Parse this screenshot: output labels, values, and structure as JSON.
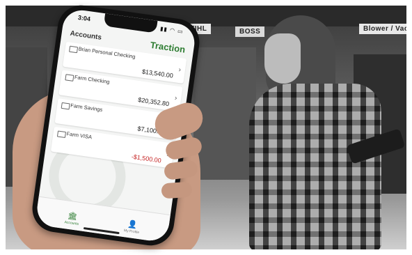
{
  "store": {
    "signs": [
      "STIHL",
      "BOSS",
      "Blower / Vacs"
    ]
  },
  "phone": {
    "status_time": "3:04",
    "status_icons": "▮▮ ◠ ▭",
    "header_title": "Accounts",
    "brand": "Traction",
    "accounts": [
      {
        "name": "Brian Personal Checking",
        "amount": "$13,540.00",
        "negative": false
      },
      {
        "name": "Farm Checking",
        "amount": "$20,352.80",
        "negative": false
      },
      {
        "name": "Farm Savings",
        "amount": "$7,100.00",
        "negative": false
      },
      {
        "name": "Farm VISA",
        "amount": "-$1,500.00",
        "negative": true
      }
    ],
    "tabs": [
      {
        "label": "Accounts",
        "icon": "bank-icon",
        "active": true
      },
      {
        "label": "My Profile",
        "icon": "user-icon",
        "active": false
      }
    ]
  },
  "colors": {
    "brand_green": "#2e7d32",
    "negative_red": "#c62828"
  }
}
